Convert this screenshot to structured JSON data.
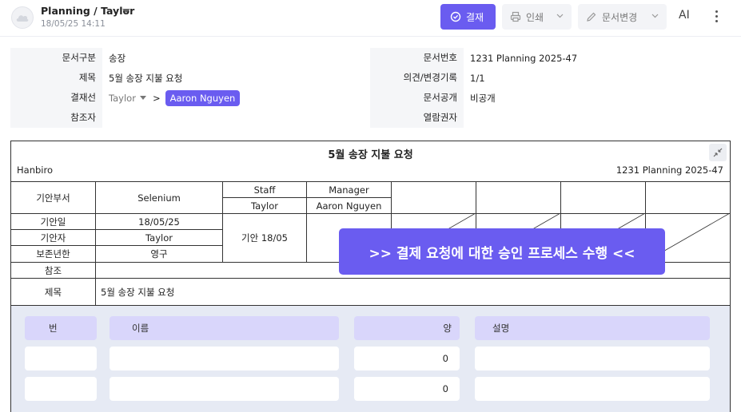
{
  "header": {
    "title": "Planning / Taylor",
    "subtitle": "18/05/25 14:11",
    "approve_label": "결재",
    "print_label": "인쇄",
    "doc_change_label": "문서변경",
    "ai_label": "AI"
  },
  "meta_left": {
    "doc_type_label": "문서구분",
    "doc_type_value": "송장",
    "subject_label": "제목",
    "subject_value": "5월 송장 지불 요청",
    "approval_line_label": "결재선",
    "approver_from": "Taylor",
    "arrow": ">",
    "approver_to": "Aaron Nguyen",
    "cc_label": "참조자"
  },
  "meta_right": {
    "doc_no_label": "문서번호",
    "doc_no_value": "1231 Planning 2025-47",
    "opinion_label": "의견/변경기록",
    "opinion_value": "1/1",
    "public_label": "문서공개",
    "public_value": "비공개",
    "viewer_label": "열람권자"
  },
  "doc": {
    "title": "5월 송장 지불 요청",
    "company": "Hanbiro",
    "doc_no": "1231 Planning 2025-47",
    "dept_label": "기안부서",
    "dept_value": "Selenium",
    "staff_label": "Staff",
    "manager_label": "Manager",
    "staff_name": "Taylor",
    "manager_name": "Aaron Nguyen",
    "date_label": "기안일",
    "date_value": "18/05/25",
    "drafter_label": "기안자",
    "drafter_value": "Taylor",
    "retention_label": "보존년한",
    "retention_value": "영구",
    "stamp": "기안 18/05",
    "ref_label": "참조",
    "subject_label": "제목",
    "subject_value": "5월 송장 지불 요청"
  },
  "banner": ">> 결제 요청에 대한 승인 프로세스 수행 <<",
  "items": {
    "headers": [
      "번",
      "이름",
      "양",
      "설명"
    ],
    "rows": [
      {
        "no": "",
        "name": "",
        "qty": "0",
        "desc": ""
      },
      {
        "no": "",
        "name": "",
        "qty": "0",
        "desc": ""
      }
    ]
  },
  "colors": {
    "accent": "#6a5cf0",
    "header_fill": "#d9d6fb",
    "panel_bg": "#e6eaf4"
  }
}
